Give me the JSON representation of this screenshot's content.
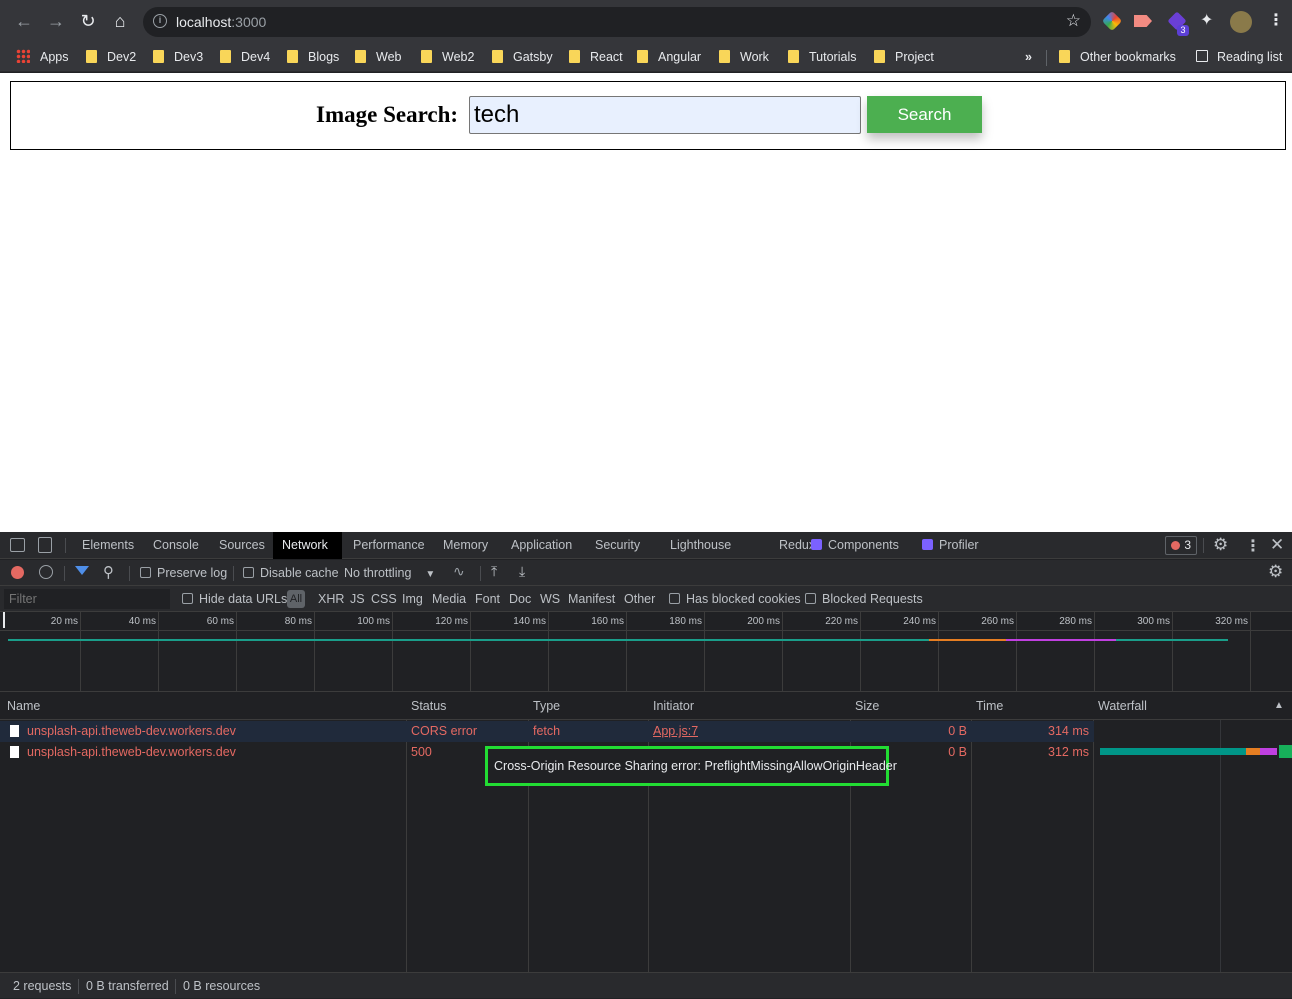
{
  "browser": {
    "url_host": "localhost",
    "url_port": ":3000",
    "bookmarks": [
      "Apps",
      "Dev2",
      "Dev3",
      "Dev4",
      "Blogs",
      "Web",
      "Web2",
      "Gatsby",
      "React",
      "Angular",
      "Work",
      "Tutorials",
      "Project"
    ],
    "overflow_label": "»",
    "other_bookmarks": "Other bookmarks",
    "reading_list": "Reading list",
    "extension_badge": "3"
  },
  "page": {
    "search_label": "Image Search:",
    "search_value": "tech",
    "search_button": "Search"
  },
  "devtools": {
    "tabs": [
      "Elements",
      "Console",
      "Sources",
      "Network",
      "Performance",
      "Memory",
      "Application",
      "Security",
      "Lighthouse",
      "Redux",
      "Components",
      "Profiler"
    ],
    "active_tab": "Network",
    "error_count": "3",
    "toolbar": {
      "preserve_log": "Preserve log",
      "disable_cache": "Disable cache",
      "throttling": "No throttling"
    },
    "filterbar": {
      "filter_placeholder": "Filter",
      "hide_data_urls": "Hide data URLs",
      "all": "All",
      "types": [
        "XHR",
        "JS",
        "CSS",
        "Img",
        "Media",
        "Font",
        "Doc",
        "WS",
        "Manifest",
        "Other"
      ],
      "has_blocked_cookies": "Has blocked cookies",
      "blocked_requests": "Blocked Requests"
    },
    "timeline_ticks": [
      "20 ms",
      "40 ms",
      "60 ms",
      "80 ms",
      "100 ms",
      "120 ms",
      "140 ms",
      "160 ms",
      "180 ms",
      "200 ms",
      "220 ms",
      "240 ms",
      "260 ms",
      "280 ms",
      "300 ms",
      "320 ms"
    ],
    "columns": [
      "Name",
      "Status",
      "Type",
      "Initiator",
      "Size",
      "Time",
      "Waterfall"
    ],
    "rows": [
      {
        "name": "unsplash-api.theweb-dev.workers.dev",
        "status": "CORS error",
        "type": "fetch",
        "initiator": "App.js:7",
        "size": "0 B",
        "time": "314 ms"
      },
      {
        "name": "unsplash-api.theweb-dev.workers.dev",
        "status": "500",
        "type": "",
        "initiator": "",
        "size": "0 B",
        "time": "312 ms"
      }
    ],
    "tooltip": "Cross-Origin Resource Sharing error: PreflightMissingAllowOriginHeader",
    "status": {
      "requests": "2 requests",
      "transferred": "0 B transferred",
      "resources": "0 B resources"
    },
    "colors": {
      "error": "#e46962",
      "waterfall_wait": "#009688",
      "waterfall_receive": "#e67e22",
      "waterfall_extra": "#c040e0"
    }
  }
}
